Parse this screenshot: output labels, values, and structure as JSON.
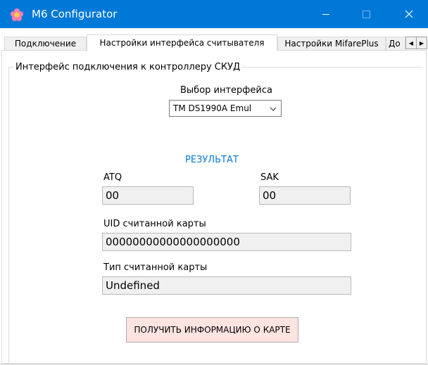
{
  "window": {
    "title": "M6 Configurator"
  },
  "tabs": [
    {
      "label": "Подключение"
    },
    {
      "label": "Настройки интерфейса считывателя"
    },
    {
      "label": "Настройки MifarePlus"
    },
    {
      "label": "До"
    }
  ],
  "group": {
    "legend": "Интерфейс подключения к контроллеру СКУД",
    "interface_label": "Выбор интерфейса",
    "interface_value": "TM DS1990A Emul",
    "result_label": "РЕЗУЛЬТАТ",
    "atq_label": "ATQ",
    "atq_value": "00",
    "sak_label": "SAK",
    "sak_value": "00",
    "uid_label": "UID считанной карты",
    "uid_value": "00000000000000000000",
    "type_label": "Тип считанной карты",
    "type_value": "Undefined",
    "button_label": "ПОЛУЧИТЬ ИНФОРМАЦИЮ О КАРТЕ"
  },
  "colors": {
    "titlebar": "#0078d7",
    "result_text": "#0a78d4",
    "button_bg": "#ffe4e1",
    "field_bg": "#f0f0f0"
  },
  "icons": {
    "app": "flower-icon",
    "minimize": "minimize-icon",
    "maximize": "maximize-icon",
    "close": "close-icon",
    "dropdown": "chevron-down-icon"
  }
}
